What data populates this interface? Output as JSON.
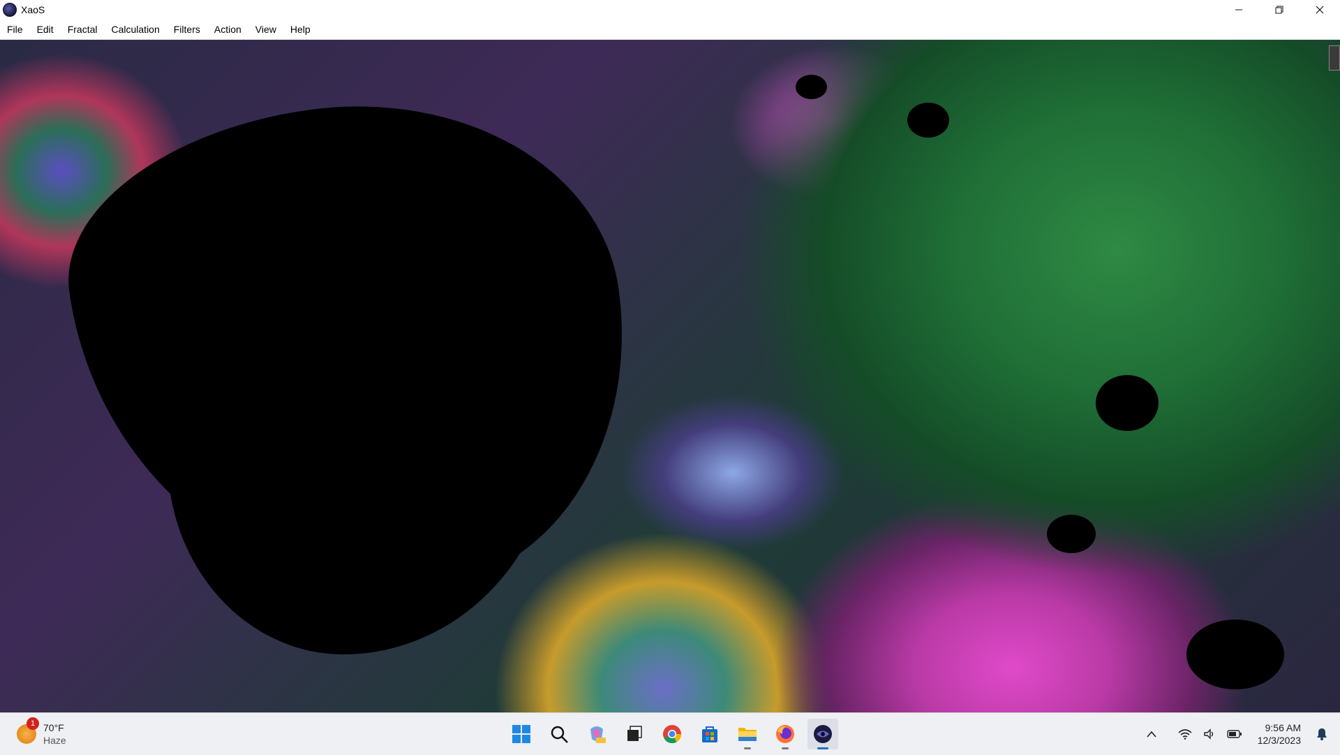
{
  "window": {
    "title": "XaoS",
    "controls": {
      "minimize": "—",
      "restore": "❐",
      "close": "✕"
    }
  },
  "menu": {
    "items": [
      "File",
      "Edit",
      "Fractal",
      "Calculation",
      "Filters",
      "Action",
      "View",
      "Help"
    ]
  },
  "canvas": {
    "description_colors": [
      "#000000",
      "#2f8a44",
      "#e04ac9",
      "#5b4ec0",
      "#8da8e6"
    ]
  },
  "taskbar": {
    "weather": {
      "temperature": "70°F",
      "condition": "Haze",
      "badge": "1"
    },
    "pinned": [
      {
        "name": "start-icon"
      },
      {
        "name": "search-icon"
      },
      {
        "name": "copilot-icon"
      },
      {
        "name": "task-view-icon"
      },
      {
        "name": "chrome-icon"
      },
      {
        "name": "store-icon"
      },
      {
        "name": "file-explorer-icon"
      },
      {
        "name": "firefox-icon"
      },
      {
        "name": "xaos-icon"
      }
    ],
    "tray": {
      "chevron": "^",
      "time": "9:56 AM",
      "date": "12/3/2023"
    }
  }
}
